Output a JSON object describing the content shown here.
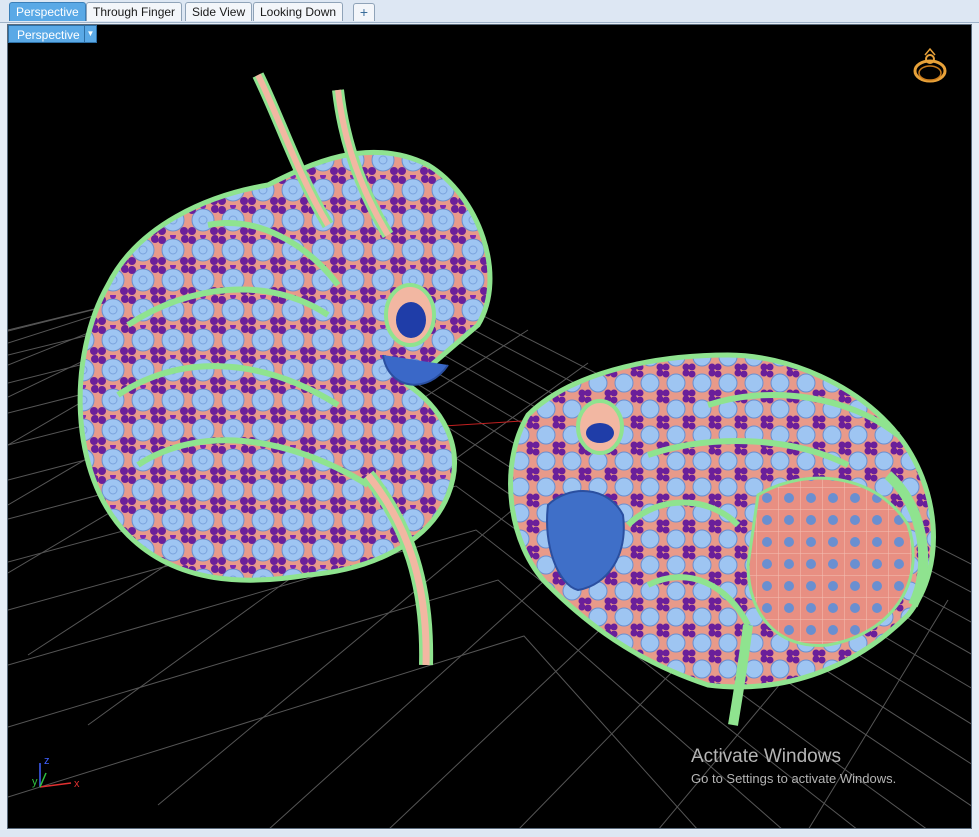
{
  "tabs": [
    {
      "label": "Perspective",
      "active": true
    },
    {
      "label": "Through Finger",
      "active": false
    },
    {
      "label": "Side View",
      "active": false
    },
    {
      "label": "Looking Down",
      "active": false
    }
  ],
  "add_tab_icon": "plus-icon",
  "viewport": {
    "label": "Perspective",
    "dropdown_icon": "chevron-down-icon",
    "ring_icon": "ring-icon"
  },
  "axes": {
    "x": "x",
    "y": "y",
    "z": "z"
  },
  "watermark": {
    "title": "Activate Windows",
    "subtitle": "Go to Settings to activate Windows."
  },
  "colors": {
    "accent": "#5aa9e6",
    "background": "#000000",
    "grid": "#555555",
    "gem": "#9ec5f2",
    "prong": "#6a1f9a",
    "metal": "#eeaa99",
    "rim": "#8fe38f",
    "x_axis": "#e03030",
    "y_axis": "#30c040",
    "z_axis": "#4060ff"
  }
}
